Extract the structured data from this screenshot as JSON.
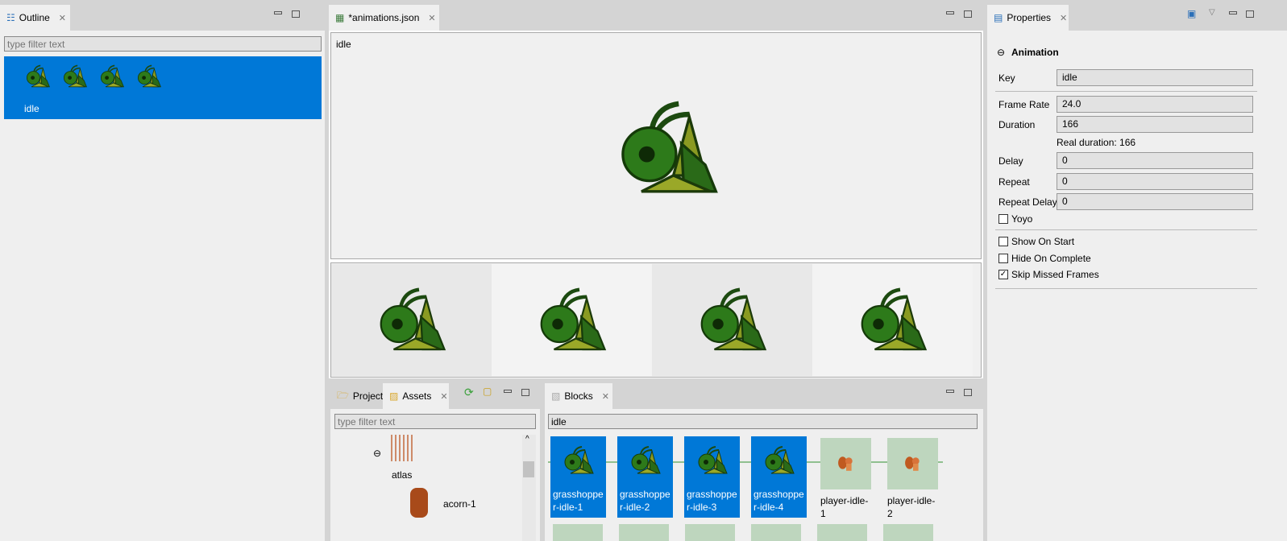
{
  "outline": {
    "tab": "Outline",
    "filter_placeholder": "type filter text",
    "item_label": "idle",
    "frame_count": 4
  },
  "editor": {
    "tab": "*animations.json",
    "animation_key": "idle",
    "frames": [
      "grasshopper-idle-1",
      "grasshopper-idle-2",
      "grasshopper-idle-3",
      "grasshopper-idle-4"
    ]
  },
  "properties": {
    "tab": "Properties",
    "section": "Animation",
    "key_label": "Key",
    "key": "idle",
    "frame_rate_label": "Frame Rate",
    "frame_rate": "24.0",
    "duration_label": "Duration",
    "duration": "166",
    "real_duration": "Real duration: 166",
    "delay_label": "Delay",
    "delay": "0",
    "repeat_label": "Repeat",
    "repeat": "0",
    "repeat_delay_label": "Repeat Delay",
    "repeat_delay": "0",
    "yoyo_label": "Yoyo",
    "yoyo": false,
    "show_on_start_label": "Show On Start",
    "show_on_start": false,
    "hide_on_complete_label": "Hide On Complete",
    "hide_on_complete": false,
    "skip_missed_label": "Skip Missed Frames",
    "skip_missed": true
  },
  "assets": {
    "tab_project": "Project",
    "tab_assets": "Assets",
    "filter_placeholder": "type filter text",
    "items": [
      "atlas",
      "acorn-1"
    ]
  },
  "blocks": {
    "tab": "Blocks",
    "filter": "idle",
    "items": [
      {
        "label": "grasshopper-idle-1",
        "selected": true
      },
      {
        "label": "grasshopper-idle-2",
        "selected": true
      },
      {
        "label": "grasshopper-idle-3",
        "selected": true
      },
      {
        "label": "grasshopper-idle-4",
        "selected": true
      },
      {
        "label": "player-idle-1",
        "selected": false
      },
      {
        "label": "player-idle-2",
        "selected": false
      }
    ]
  },
  "colors": {
    "selection": "#0078d7",
    "block_bg": "#bed6be"
  }
}
